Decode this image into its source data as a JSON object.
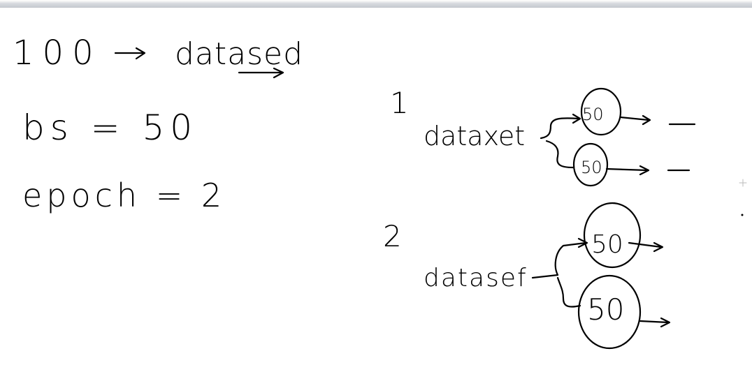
{
  "line1": {
    "number": "100",
    "arrow": "→",
    "word": "datased"
  },
  "line2": {
    "text": "bs = 50"
  },
  "line3": {
    "text": "epoch = 2"
  },
  "epoch1": {
    "label": "1",
    "word": "dataxet",
    "batch_top": "50",
    "batch_bottom": "50",
    "dash": "—"
  },
  "epoch2": {
    "label": "2",
    "word": "datasef",
    "batch_top": "50",
    "batch_bottom": "50"
  }
}
